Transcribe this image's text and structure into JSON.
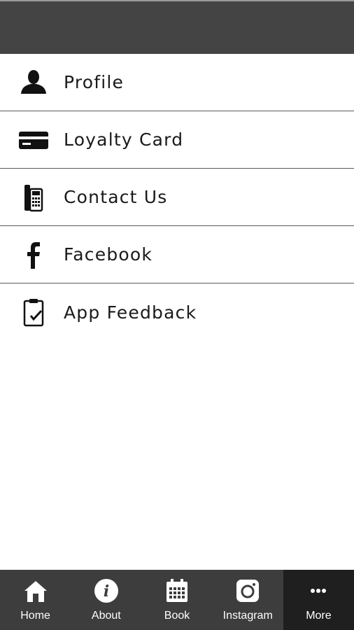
{
  "menu": {
    "items": [
      {
        "label": "Profile",
        "icon": "person-icon"
      },
      {
        "label": "Loyalty Card",
        "icon": "credit-card-icon"
      },
      {
        "label": "Contact Us",
        "icon": "desk-phone-icon"
      },
      {
        "label": "Facebook",
        "icon": "facebook-icon"
      },
      {
        "label": "App Feedback",
        "icon": "clipboard-check-icon"
      }
    ]
  },
  "tabbar": {
    "items": [
      {
        "label": "Home",
        "icon": "home-icon"
      },
      {
        "label": "About",
        "icon": "info-icon"
      },
      {
        "label": "Book",
        "icon": "calendar-icon"
      },
      {
        "label": "Instagram",
        "icon": "instagram-icon"
      },
      {
        "label": "More",
        "icon": "more-dots-icon"
      }
    ],
    "active_label": "More"
  },
  "colors": {
    "header_bg": "#444444",
    "tabbar_bg": "#3d3d3d",
    "tab_active_bg": "#1f1f1f",
    "divider": "#5a5a5a"
  }
}
